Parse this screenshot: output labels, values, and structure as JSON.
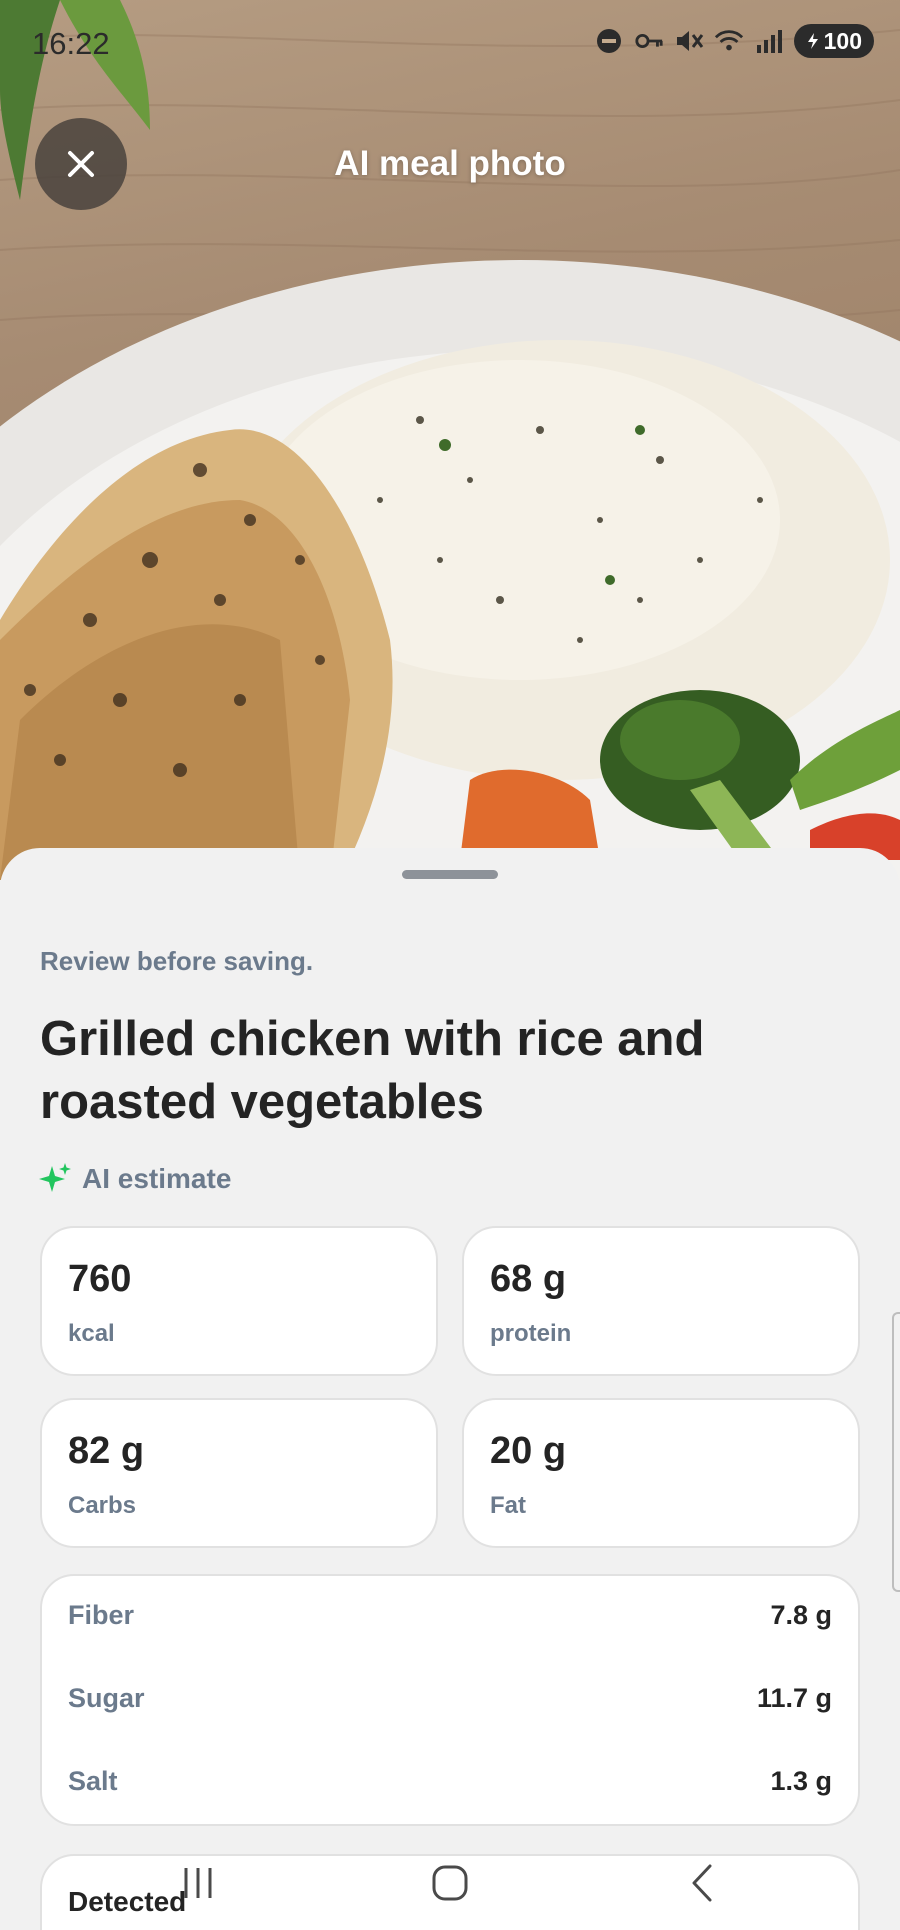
{
  "status_bar": {
    "time": "16:22",
    "battery": "100",
    "icons": [
      "dnd-icon",
      "vpn-key-icon",
      "mute-icon",
      "wifi-icon",
      "signal-icon",
      "battery-icon"
    ]
  },
  "header": {
    "title": "AI meal photo",
    "close_icon": "close-icon"
  },
  "sheet": {
    "review_text": "Review before saving.",
    "meal_title": "Grilled chicken with rice and roasted vegetables",
    "ai_label": "AI estimate",
    "ai_icon": "sparkle-icon",
    "accent_color": "#22c55e",
    "macros": [
      {
        "value": "760",
        "unit": "kcal"
      },
      {
        "value": "68 g",
        "unit": "protein"
      },
      {
        "value": "82 g",
        "unit": "Carbs"
      },
      {
        "value": "20 g",
        "unit": "Fat"
      }
    ],
    "details": [
      {
        "label": "Fiber",
        "value": "7.8 g"
      },
      {
        "label": "Sugar",
        "value": "11.7 g"
      },
      {
        "label": "Salt",
        "value": "1.3 g"
      }
    ],
    "detected_label": "Detected"
  },
  "nav_bar": {
    "icons": [
      "recents-icon",
      "home-icon",
      "back-icon"
    ]
  }
}
